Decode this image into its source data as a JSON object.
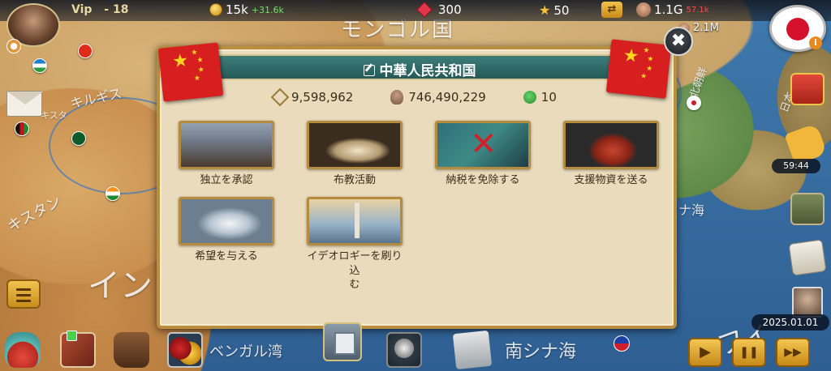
{
  "topbar": {
    "vip_label": "Vip",
    "vip_level": "- 18",
    "money": "15k",
    "money_gain": "+31.6k",
    "gems": "300",
    "stars": "50",
    "population": "1.1G",
    "population_change": "57.1k",
    "population2": "2.1M"
  },
  "map_labels": {
    "mongolia": "モンゴル国",
    "kyrgyz": "キルギス",
    "kazakh_partial": "キスタ",
    "turkmen": "キスタン",
    "india": "イン",
    "bengal_bay": "ベンガル湾",
    "south_china_sea": "南シナ海",
    "sea_right": "ナ海",
    "philippines_partial": "フィ",
    "japan_partial": "日本",
    "korea_partial": "北朝鮮"
  },
  "dialog": {
    "title": "中華人民共和国",
    "area": "9,598,962",
    "population": "746,490,229",
    "happiness": "10",
    "actions": [
      {
        "label": "独立を承認"
      },
      {
        "label": "布教活動"
      },
      {
        "label": "納税を免除する"
      },
      {
        "label": "支援物資を送る"
      },
      {
        "label": "希望を与える"
      },
      {
        "label": "イデオロギーを刷り込\nむ"
      }
    ]
  },
  "right_panel": {
    "timer": "59:44",
    "date": "2025.01.01"
  },
  "controls": {
    "play": "▶",
    "pause": "❚❚",
    "fast": "▶▶"
  },
  "colors": {
    "dialog_bg": "#e9dbbc",
    "dialog_border": "#b98e3f",
    "header_teal": "#2f6b69",
    "gold_button": "#f2c34e",
    "china_red": "#d71f1f"
  },
  "icons": {
    "close": "close-icon",
    "edit": "edit-icon",
    "menu": "hamburger-menu-icon"
  }
}
